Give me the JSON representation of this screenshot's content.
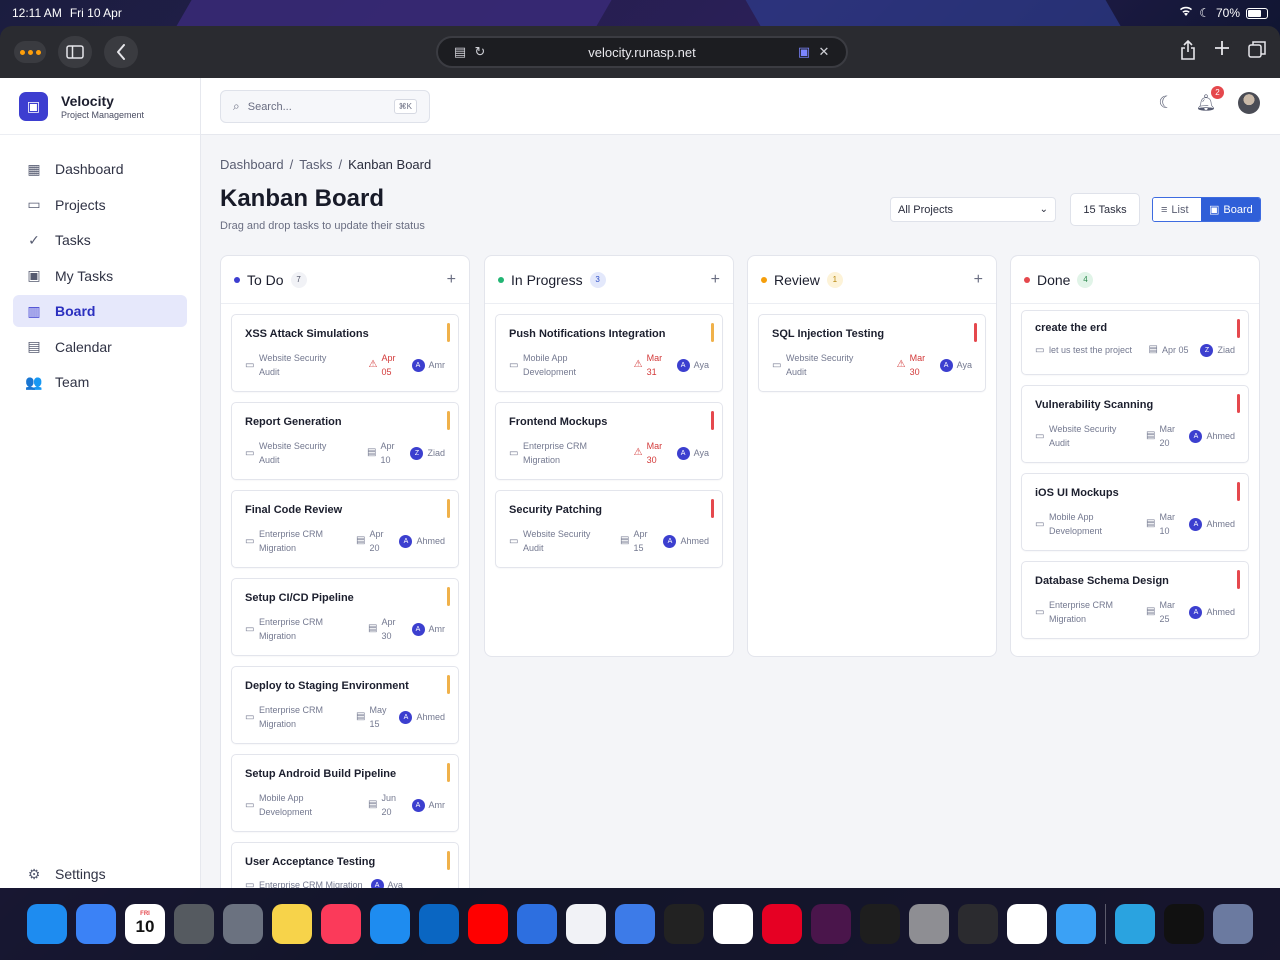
{
  "status_bar": {
    "time": "12:11 AM",
    "date": "Fri 10 Apr",
    "battery": "70%",
    "battery_level": 0.7
  },
  "browser": {
    "url": "velocity.runasp.net"
  },
  "brand": {
    "name": "Velocity",
    "subtitle": "Project Management"
  },
  "sidebar": {
    "items": [
      {
        "label": "Dashboard",
        "icon": "dashboard-icon"
      },
      {
        "label": "Projects",
        "icon": "folder-icon"
      },
      {
        "label": "Tasks",
        "icon": "check-circle-icon"
      },
      {
        "label": "My Tasks",
        "icon": "user-badge-icon"
      },
      {
        "label": "Board",
        "icon": "board-icon",
        "active": true
      },
      {
        "label": "Calendar",
        "icon": "calendar-icon"
      },
      {
        "label": "Team",
        "icon": "team-icon"
      }
    ],
    "settings_label": "Settings"
  },
  "topbar": {
    "search_placeholder": "Search...",
    "search_shortcut": "⌘K",
    "notification_count": "2"
  },
  "breadcrumb": [
    "Dashboard",
    "/",
    "Tasks",
    "/",
    "Kanban Board"
  ],
  "page": {
    "title": "Kanban Board",
    "subtitle": "Drag and drop tasks to update their status",
    "project_filter": "All Projects",
    "task_count": "15 Tasks",
    "view_list": "List",
    "view_board": "Board"
  },
  "colors": {
    "todo": "#3d3ed0",
    "in_progress": "#22b573",
    "review": "#f59e0b",
    "done": "#e5484d",
    "priority_medium": "#f0b14a",
    "priority_high": "#e5484d",
    "brand": "#3d3ed0",
    "overdue": "#d33a3a"
  },
  "columns": {
    "todo": {
      "title": "To Do",
      "count": "7",
      "cards": [
        {
          "title": "XSS Attack Simulations",
          "project": "Website Security Audit",
          "date": "Apr 05",
          "overdue": true,
          "assignee_initial": "A",
          "assignee": "Amr"
        },
        {
          "title": "Report Generation",
          "project": "Website Security Audit",
          "date": "Apr 10",
          "assignee_initial": "Z",
          "assignee": "Ziad"
        },
        {
          "title": "Final Code Review",
          "project": "Enterprise CRM Migration",
          "date": "Apr 20",
          "assignee_initial": "A",
          "assignee": "Ahmed"
        },
        {
          "title": "Setup CI/CD Pipeline",
          "project": "Enterprise CRM Migration",
          "date": "Apr 30",
          "assignee_initial": "A",
          "assignee": "Amr"
        },
        {
          "title": "Deploy to Staging Environment",
          "project": "Enterprise CRM Migration",
          "date": "May 15",
          "assignee_initial": "A",
          "assignee": "Ahmed"
        },
        {
          "title": "Setup Android Build Pipeline",
          "project": "Mobile App Development",
          "date": "Jun 20",
          "assignee_initial": "A",
          "assignee": "Amr"
        },
        {
          "title": "User Acceptance Testing",
          "project": "Enterprise CRM Migration",
          "date": "",
          "assignee_initial": "A",
          "assignee": "Aya"
        }
      ]
    },
    "in_progress": {
      "title": "In Progress",
      "count": "3",
      "cards": [
        {
          "title": "Push Notifications Integration",
          "project": "Mobile App Development",
          "date": "Mar 31",
          "overdue": true,
          "assignee_initial": "A",
          "assignee": "Aya"
        },
        {
          "title": "Frontend Mockups",
          "project": "Enterprise CRM Migration",
          "date": "Mar 30",
          "overdue": true,
          "assignee_initial": "A",
          "assignee": "Aya"
        },
        {
          "title": "Security Patching",
          "project": "Website Security Audit",
          "date": "Apr 15",
          "assignee_initial": "A",
          "assignee": "Ahmed"
        }
      ]
    },
    "review": {
      "title": "Review",
      "count": "1",
      "cards": [
        {
          "title": "SQL Injection Testing",
          "project": "Website Security Audit",
          "date": "Mar 30",
          "overdue": true,
          "assignee_initial": "A",
          "assignee": "Aya"
        }
      ]
    },
    "done": {
      "title": "Done",
      "count": "4",
      "cards": [
        {
          "title": "create the erd",
          "project": "let us test the project",
          "date": "Apr 05",
          "assignee_initial": "Z",
          "assignee": "Ziad"
        },
        {
          "title": "Vulnerability Scanning",
          "project": "Website Security Audit",
          "date": "Mar 20",
          "assignee_initial": "A",
          "assignee": "Ahmed"
        },
        {
          "title": "iOS UI Mockups",
          "project": "Mobile App Development",
          "date": "Mar 10",
          "assignee_initial": "A",
          "assignee": "Ahmed"
        },
        {
          "title": "Database Schema Design",
          "project": "Enterprise CRM Migration",
          "date": "Mar 25",
          "assignee_initial": "A",
          "assignee": "Ahmed"
        }
      ]
    }
  },
  "dock": {
    "apps": [
      "Safari",
      "Mail",
      "Calendar",
      "Calculator",
      "Canister",
      "Notes",
      "Music",
      "App Store",
      "LinkedIn",
      "YouTube",
      "Translate",
      "Freeform",
      "Google Translate",
      "ChatGPT",
      "Notion",
      "Pinterest",
      "Slack",
      "Figma",
      "Settings",
      "Camera",
      "Photos",
      "Files",
      "Telegram",
      "TV",
      "App Library"
    ],
    "calendar_day": "10",
    "calendar_weekday": "FRI"
  }
}
